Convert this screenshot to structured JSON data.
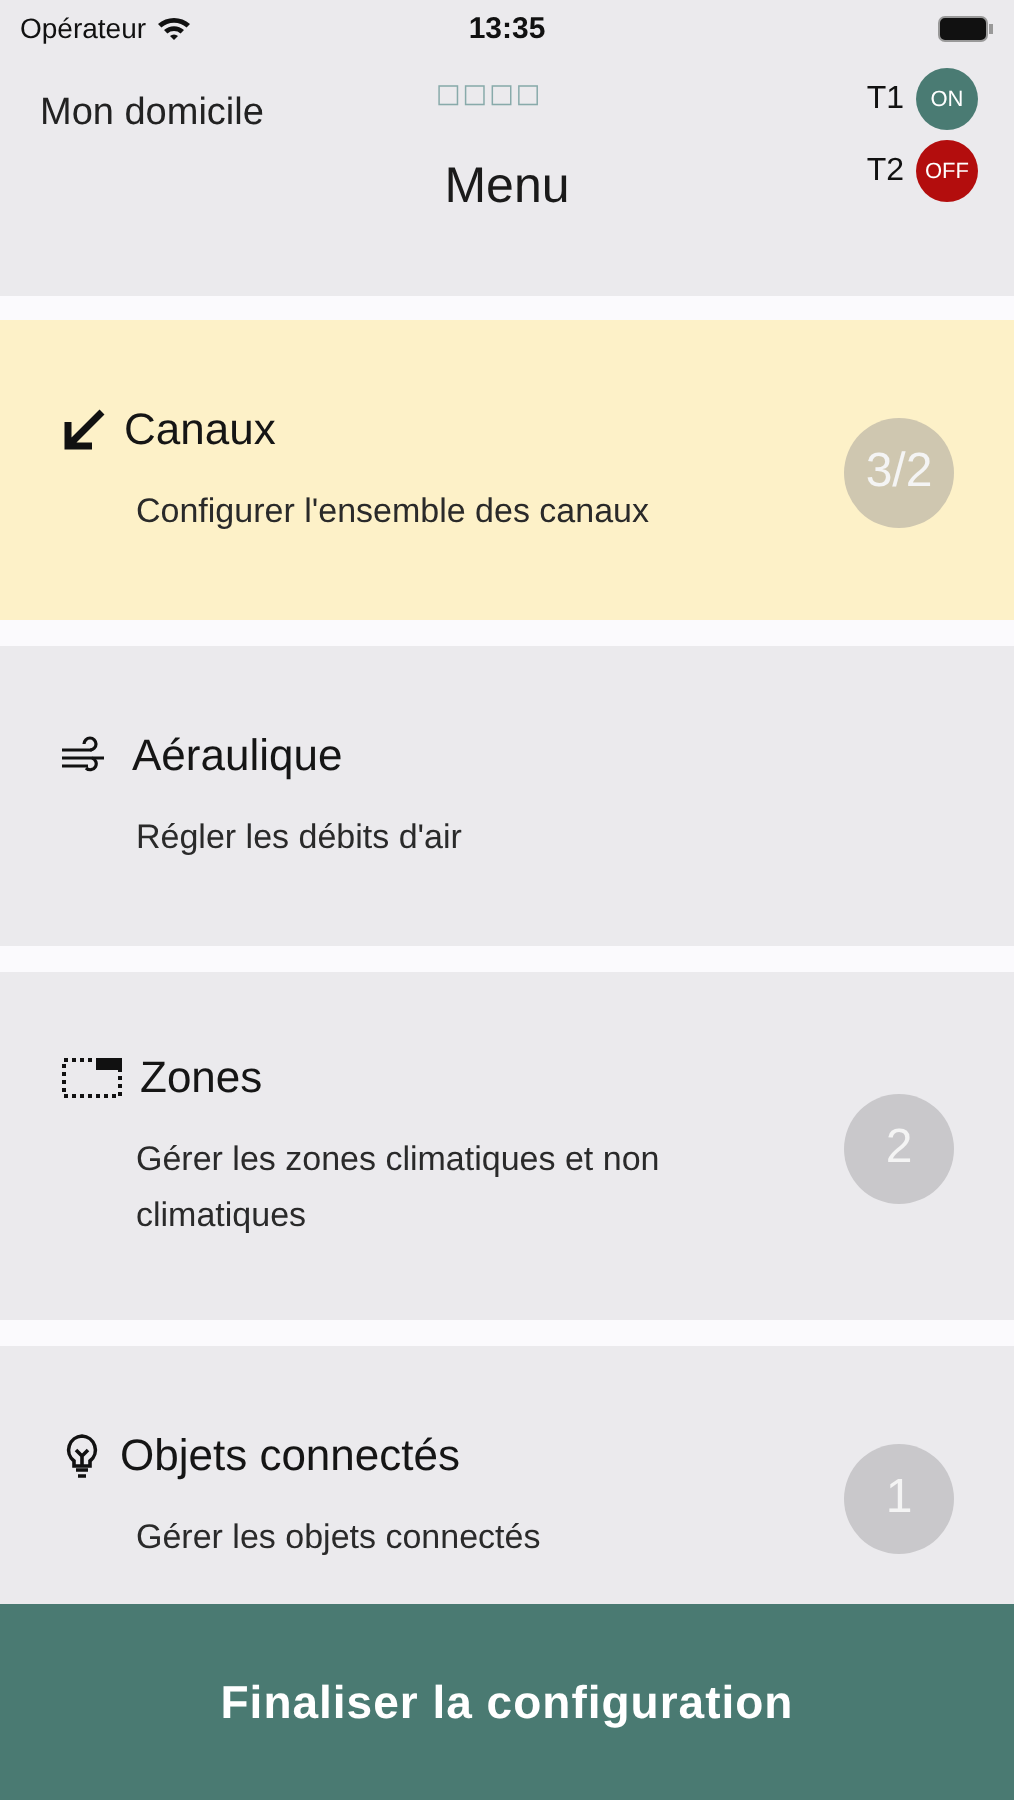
{
  "status_bar": {
    "carrier": "Opérateur",
    "time": "13:35"
  },
  "header": {
    "home": "Mon domicile",
    "indicator": "□□□□",
    "title": "Menu",
    "terminals": [
      {
        "name": "T1",
        "state": "ON",
        "on": true
      },
      {
        "name": "T2",
        "state": "OFF",
        "on": false
      }
    ]
  },
  "menu": [
    {
      "title": "Canaux",
      "subtitle": "Configurer l'ensemble des canaux",
      "badge": "3/2",
      "highlighted": true
    },
    {
      "title": "Aéraulique",
      "subtitle": "Régler les débits d'air",
      "highlighted": false
    },
    {
      "title": "Zones",
      "subtitle": "Gérer les zones climatiques et non climatiques",
      "badge": "2",
      "highlighted": false
    },
    {
      "title": "Objets connectés",
      "subtitle": "Gérer les objets connectés",
      "badge": "1",
      "highlighted": false
    }
  ],
  "footer_button": "Finaliser la configuration"
}
